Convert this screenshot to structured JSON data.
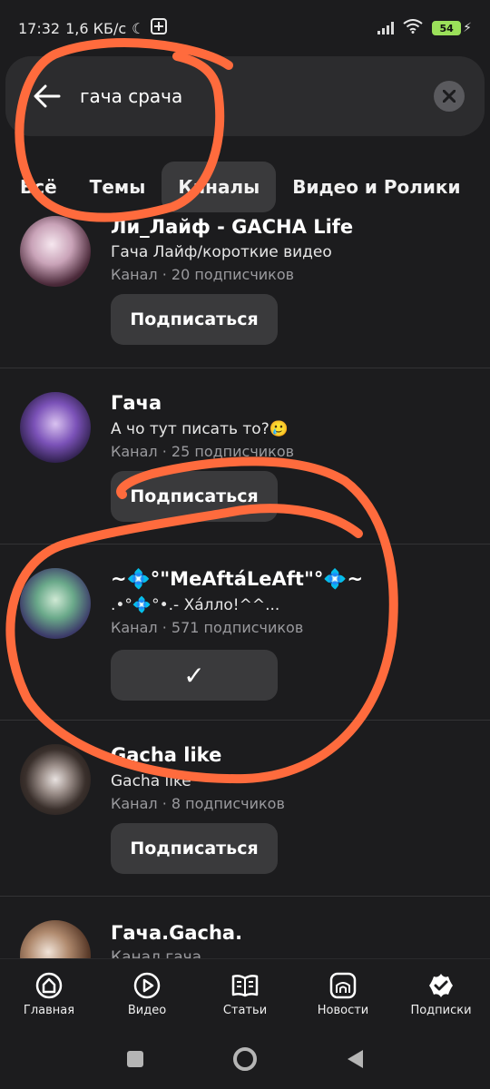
{
  "status": {
    "time": "17:32",
    "speed": "1,6 КБ/с",
    "battery": "54"
  },
  "search": {
    "query": "гача срача"
  },
  "tabs": [
    {
      "label": "Всё"
    },
    {
      "label": "Темы"
    },
    {
      "label": "Каналы"
    },
    {
      "label": "Видео и Ролики"
    }
  ],
  "channels": [
    {
      "name": "Ли_Лайф - GACHA Life",
      "desc": "Гача Лайф/короткие видео",
      "meta": "Канал · 20 подписчиков",
      "button": "Подписаться"
    },
    {
      "name": "Гача",
      "desc": "А чо тут писать то?🥲",
      "meta": "Канал · 25 подписчиков",
      "button": "Подписаться"
    },
    {
      "name": "~💠°\"MeAftáLeAft\"°💠~",
      "desc": ".•°💠°•.- Xáлло!^^...",
      "meta": "Канал · 571 подписчиков",
      "button": "✓"
    },
    {
      "name": "Gacha like",
      "desc": "Gacha like",
      "meta": "Канал · 8 подписчиков",
      "button": "Подписаться"
    },
    {
      "name": "Гача.Gacha.",
      "desc": "Канал гача",
      "meta": "",
      "button": ""
    }
  ],
  "nav": [
    {
      "label": "Главная",
      "icon": "home-icon"
    },
    {
      "label": "Видео",
      "icon": "video-icon"
    },
    {
      "label": "Статьи",
      "icon": "articles-icon"
    },
    {
      "label": "Новости",
      "icon": "news-icon"
    },
    {
      "label": "Подписки",
      "icon": "subscriptions-icon"
    }
  ],
  "colors": {
    "background": "#1c1c1e",
    "surface": "#2c2c2e",
    "button": "#3a3a3c",
    "annotation": "#ff6b3d",
    "battery": "#9be05a"
  }
}
